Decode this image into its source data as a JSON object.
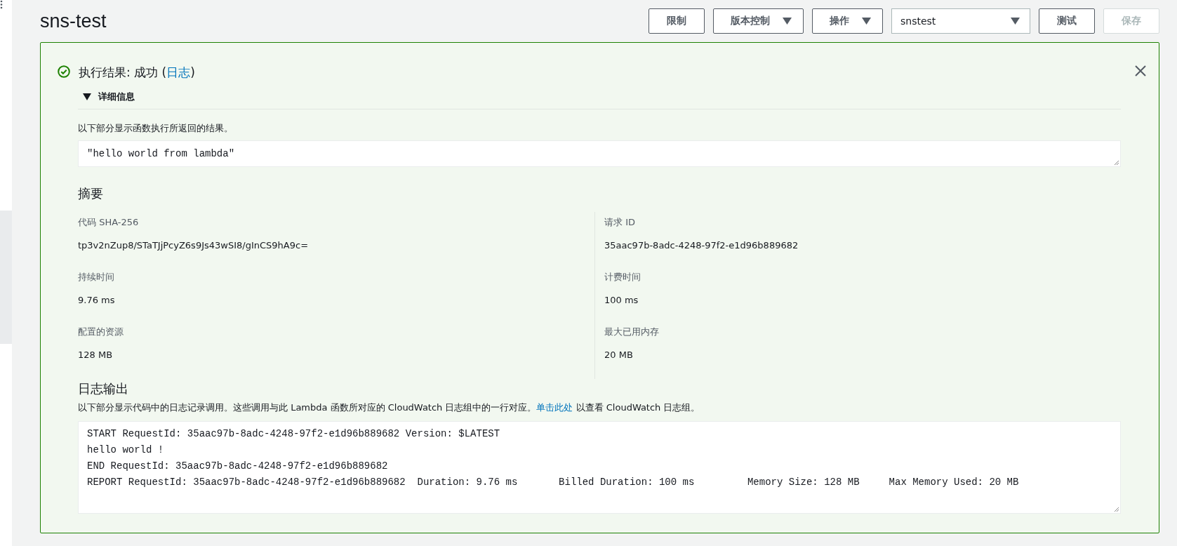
{
  "page_title": "sns-test",
  "toolbar": [
    {
      "kind": "button",
      "label": "限制",
      "disabled": false
    },
    {
      "kind": "dropdown",
      "label": "版本控制",
      "disabled": false
    },
    {
      "kind": "dropdown",
      "label": "操作",
      "disabled": false
    },
    {
      "kind": "select",
      "label": "snstest",
      "disabled": false
    },
    {
      "kind": "button",
      "label": "测试",
      "disabled": false
    },
    {
      "kind": "button",
      "label": "保存",
      "disabled": true
    }
  ],
  "result": {
    "kind": "success",
    "heading": "执行结果: 成功 (",
    "heading_link": "日志",
    "heading_end": ")",
    "details": {
      "label": "详细信息",
      "expanded": true
    },
    "description": "以下部分显示函数执行所返回的结果。",
    "output": "\"hello world from lambda\"",
    "summary_title": "摘要",
    "summary": [
      [
        {
          "label": "代码 SHA-256",
          "value": "tp3v2nZup8/STaTJjPcyZ6s9Js43wSI8/gInCS9hA9c="
        },
        {
          "label": "持续时间",
          "value": "9.76 ms"
        },
        {
          "label": "配置的资源",
          "value": "128 MB"
        }
      ],
      [
        {
          "label": "请求 ID",
          "value": "35aac97b-8adc-4248-97f2-e1d96b889682"
        },
        {
          "label": "计费时间",
          "value": "100 ms"
        },
        {
          "label": "最大已用内存",
          "value": "20 MB"
        }
      ]
    ],
    "log_title": "日志输出",
    "log_description": "以下部分显示代码中的日志记录调用。这些调用与此 Lambda 函数所对应的 CloudWatch 日志组中的一行对应。",
    "log_link": "单击此处",
    "log_description_end": " 以查看 CloudWatch 日志组。",
    "log_lines": [
      "START RequestId: 35aac97b-8adc-4248-97f2-e1d96b889682 Version: $LATEST",
      "hello world !",
      "END RequestId: 35aac97b-8adc-4248-97f2-e1d96b889682",
      "REPORT RequestId: 35aac97b-8adc-4248-97f2-e1d96b889682  Duration: 9.76 ms       Billed Duration: 100 ms         Memory Size: 128 MB     Max Memory Used: 20 MB"
    ]
  }
}
